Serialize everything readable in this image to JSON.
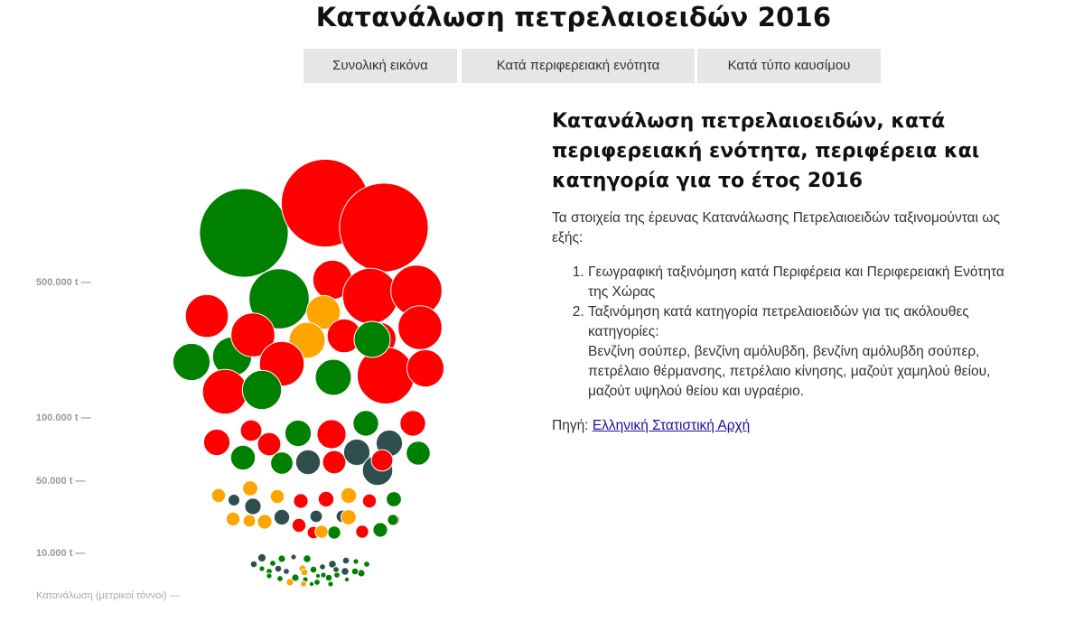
{
  "header": {
    "title": "Κατανάλωση πετρελαιοειδών 2016"
  },
  "tabs": [
    {
      "label": "Συνολική εικόνα"
    },
    {
      "label": "Κατά περιφερειακή ενότητα"
    },
    {
      "label": "Κατά τύπο καυσίμου"
    }
  ],
  "info": {
    "heading": "Κατανάλωση πετρελαιοειδών, κατά περιφερειακή ενότητα, περιφέρεια και κατηγορία για το έτος 2016",
    "intro": "Τα στοιχεία της έρευνας Κατανάλωσης Πετρελαιοειδών ταξινομούνται ως εξής:",
    "list": [
      "Γεωγραφική ταξινόμηση κατά Περιφέρεια και Περιφερειακή Ενότητα της Χώρας",
      "Ταξινόμηση κατά κατηγορία πετρελαιοειδών για τις ακόλουθες κατηγορίες:",
      "Βενζίνη σούπερ, βενζίνη αμόλυβδη, βενζίνη αμόλυβδη σούπερ, πετρέλαιο θέρμανσης, πετρέλαιο κίνησης, μαζούτ χαμηλού θείου, μαζούτ υψηλού θείου και υγραέριο."
    ],
    "source_label": "Πηγή:",
    "source_link": "Ελληνική Στατιστική Αρχή"
  },
  "colors": {
    "red": "#ff0000",
    "green": "#008000",
    "orange": "#ffa500",
    "dark": "#2f4f4f"
  },
  "chart_data": {
    "type": "bubble",
    "title": "",
    "ylabel": "Κατανάλωση (μετρικοί τόννοι) —",
    "y_ticks": [
      "500.000 t —",
      "100.000 t —",
      "50.000 t —",
      "10.000 t —"
    ],
    "groups": [
      {
        "band": ">500.000 t",
        "bubbles": [
          {
            "v": 1020000,
            "c": "green"
          },
          {
            "v": 1000000,
            "c": "red"
          },
          {
            "v": 1020000,
            "c": "red"
          },
          {
            "v": 470000,
            "c": "green"
          },
          {
            "v": 200000,
            "c": "red"
          },
          {
            "v": 400000,
            "c": "red"
          },
          {
            "v": 340000,
            "c": "red"
          },
          {
            "v": 200000,
            "c": "green"
          },
          {
            "v": 150000,
            "c": "orange"
          },
          {
            "v": 240000,
            "c": "red"
          },
          {
            "v": 250000,
            "c": "red"
          },
          {
            "v": 170000,
            "c": "orange"
          },
          {
            "v": 150000,
            "c": "red"
          },
          {
            "v": 130000,
            "c": "red"
          },
          {
            "v": 250000,
            "c": "red"
          },
          {
            "v": 180000,
            "c": "green"
          },
          {
            "v": 260000,
            "c": "red"
          },
          {
            "v": 170000,
            "c": "green"
          },
          {
            "v": 420000,
            "c": "red"
          },
          {
            "v": 180000,
            "c": "red"
          },
          {
            "v": 260000,
            "c": "red"
          },
          {
            "v": 200000,
            "c": "green"
          },
          {
            "v": 170000,
            "c": "green"
          }
        ]
      },
      {
        "band": "100.000–500.000 t",
        "bubbles": [
          {
            "v": 90000,
            "c": "red"
          },
          {
            "v": 60000,
            "c": "red"
          },
          {
            "v": 90000,
            "c": "green"
          },
          {
            "v": 70000,
            "c": "red"
          },
          {
            "v": 80000,
            "c": "green"
          },
          {
            "v": 110000,
            "c": "red"
          },
          {
            "v": 80000,
            "c": "dark"
          },
          {
            "v": 65000,
            "c": "green"
          },
          {
            "v": 75000,
            "c": "red"
          },
          {
            "v": 70000,
            "c": "red"
          },
          {
            "v": 90000,
            "c": "dark"
          },
          {
            "v": 85000,
            "c": "green"
          },
          {
            "v": 90000,
            "c": "dark"
          },
          {
            "v": 120000,
            "c": "dark"
          },
          {
            "v": 85000,
            "c": "red"
          },
          {
            "v": 75000,
            "c": "green"
          },
          {
            "v": 60000,
            "c": "red"
          }
        ]
      },
      {
        "band": "10.000–50.000 t",
        "bubbles": [
          {
            "v": 25000,
            "c": "orange"
          },
          {
            "v": 18000,
            "c": "dark"
          },
          {
            "v": 30000,
            "c": "orange"
          },
          {
            "v": 35000,
            "c": "dark"
          },
          {
            "v": 25000,
            "c": "orange"
          },
          {
            "v": 28000,
            "c": "red"
          },
          {
            "v": 32000,
            "c": "red"
          },
          {
            "v": 20000,
            "c": "dark"
          },
          {
            "v": 32000,
            "c": "orange"
          },
          {
            "v": 25000,
            "c": "red"
          },
          {
            "v": 30000,
            "c": "green"
          },
          {
            "v": 25000,
            "c": "orange"
          },
          {
            "v": 20000,
            "c": "orange"
          },
          {
            "v": 28000,
            "c": "orange"
          },
          {
            "v": 32000,
            "c": "dark"
          },
          {
            "v": 25000,
            "c": "red"
          },
          {
            "v": 20000,
            "c": "dark"
          },
          {
            "v": 30000,
            "c": "orange"
          },
          {
            "v": 22000,
            "c": "red"
          },
          {
            "v": 28000,
            "c": "green"
          },
          {
            "v": 18000,
            "c": "red"
          },
          {
            "v": 22000,
            "c": "green"
          },
          {
            "v": 20000,
            "c": "red"
          },
          {
            "v": 22000,
            "c": "orange"
          },
          {
            "v": 16000,
            "c": "green"
          }
        ]
      },
      {
        "band": "<10.000 t",
        "bubbles": [
          {
            "v": 9000,
            "c": "dark"
          },
          {
            "v": 6000,
            "c": "dark"
          },
          {
            "v": 5000,
            "c": "green"
          },
          {
            "v": 7000,
            "c": "green"
          },
          {
            "v": 4000,
            "c": "dark"
          },
          {
            "v": 8000,
            "c": "green"
          },
          {
            "v": 5000,
            "c": "green"
          },
          {
            "v": 6000,
            "c": "dark"
          },
          {
            "v": 7000,
            "c": "orange"
          },
          {
            "v": 5000,
            "c": "dark"
          },
          {
            "v": 8000,
            "c": "dark"
          },
          {
            "v": 6000,
            "c": "dark"
          },
          {
            "v": 4000,
            "c": "green"
          },
          {
            "v": 5000,
            "c": "green"
          },
          {
            "v": 7000,
            "c": "green"
          },
          {
            "v": 6000,
            "c": "green"
          },
          {
            "v": 8000,
            "c": "dark"
          },
          {
            "v": 5000,
            "c": "green"
          },
          {
            "v": 6000,
            "c": "green"
          },
          {
            "v": 7000,
            "c": "orange"
          },
          {
            "v": 5000,
            "c": "green"
          },
          {
            "v": 4000,
            "c": "green"
          },
          {
            "v": 6000,
            "c": "green"
          },
          {
            "v": 5000,
            "c": "dark"
          },
          {
            "v": 7000,
            "c": "green"
          },
          {
            "v": 4000,
            "c": "green"
          },
          {
            "v": 5000,
            "c": "green"
          },
          {
            "v": 6000,
            "c": "orange"
          },
          {
            "v": 4000,
            "c": "green"
          },
          {
            "v": 5000,
            "c": "dark"
          },
          {
            "v": 3000,
            "c": "green"
          },
          {
            "v": 4000,
            "c": "green"
          },
          {
            "v": 3000,
            "c": "green"
          },
          {
            "v": 5000,
            "c": "orange"
          },
          {
            "v": 4000,
            "c": "green"
          },
          {
            "v": 3000,
            "c": "green"
          }
        ]
      }
    ]
  }
}
